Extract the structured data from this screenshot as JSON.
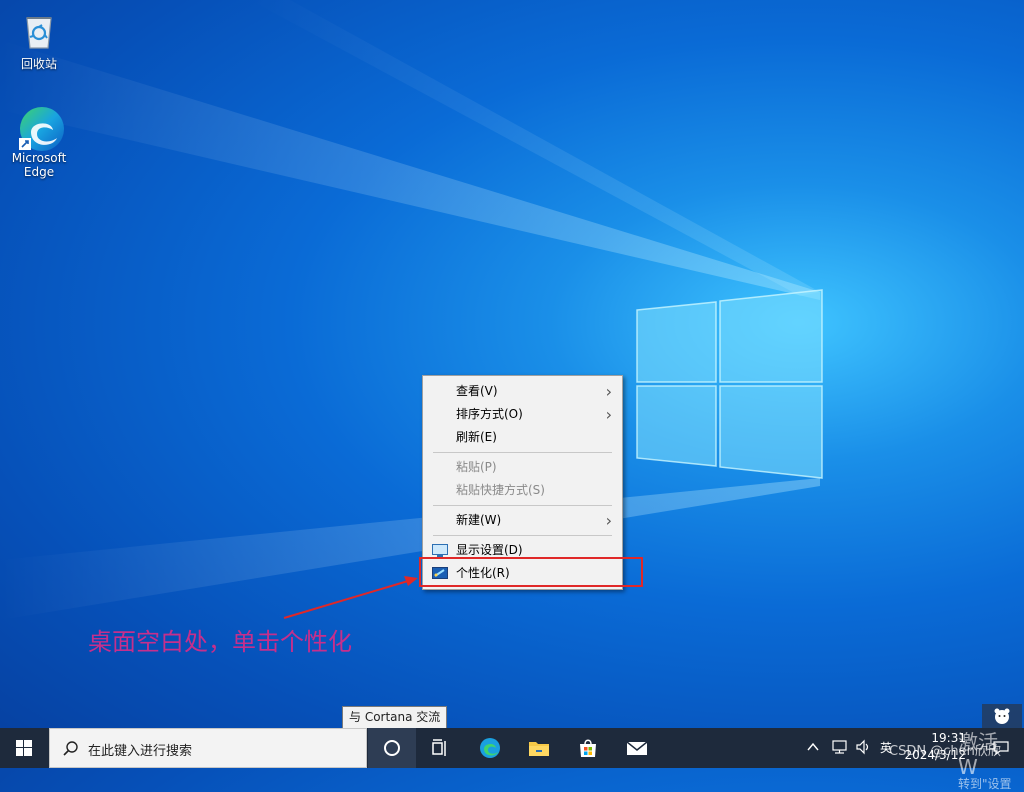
{
  "desktop": {
    "icons": [
      {
        "label": "回收站",
        "icon": "recycle-bin-icon"
      },
      {
        "label": "Microsoft Edge",
        "icon": "edge-icon"
      }
    ]
  },
  "context_menu": {
    "items": [
      {
        "label": "查看(V)",
        "submenu": true,
        "disabled": false
      },
      {
        "label": "排序方式(O)",
        "submenu": true,
        "disabled": false
      },
      {
        "label": "刷新(E)",
        "submenu": false,
        "disabled": false
      },
      {
        "label": "粘贴(P)",
        "submenu": false,
        "disabled": true
      },
      {
        "label": "粘贴快捷方式(S)",
        "submenu": false,
        "disabled": true
      },
      {
        "label": "新建(W)",
        "submenu": true,
        "disabled": false
      },
      {
        "label": "显示设置(D)",
        "submenu": false,
        "disabled": false,
        "icon": "display-settings-icon"
      },
      {
        "label": "个性化(R)",
        "submenu": false,
        "disabled": false,
        "icon": "personalize-icon"
      }
    ]
  },
  "annotation": {
    "text": "桌面空白处，单击个性化",
    "color": "#c62f8c",
    "highlight_color": "#e02828"
  },
  "tooltip": {
    "text": "与 Cortana 交流"
  },
  "taskbar": {
    "search_placeholder": "在此键入进行搜索",
    "pinned": [
      "cortana-icon",
      "task-view-icon",
      "edge-icon",
      "file-explorer-icon",
      "store-icon",
      "mail-icon"
    ],
    "tray": {
      "ime": "英",
      "time": "19:31",
      "date": "2024/3/12"
    }
  },
  "watermark": {
    "activate": "激活 W",
    "activate_sub": "转到\"设置",
    "csdn": "CSDN @chen欣欣"
  }
}
